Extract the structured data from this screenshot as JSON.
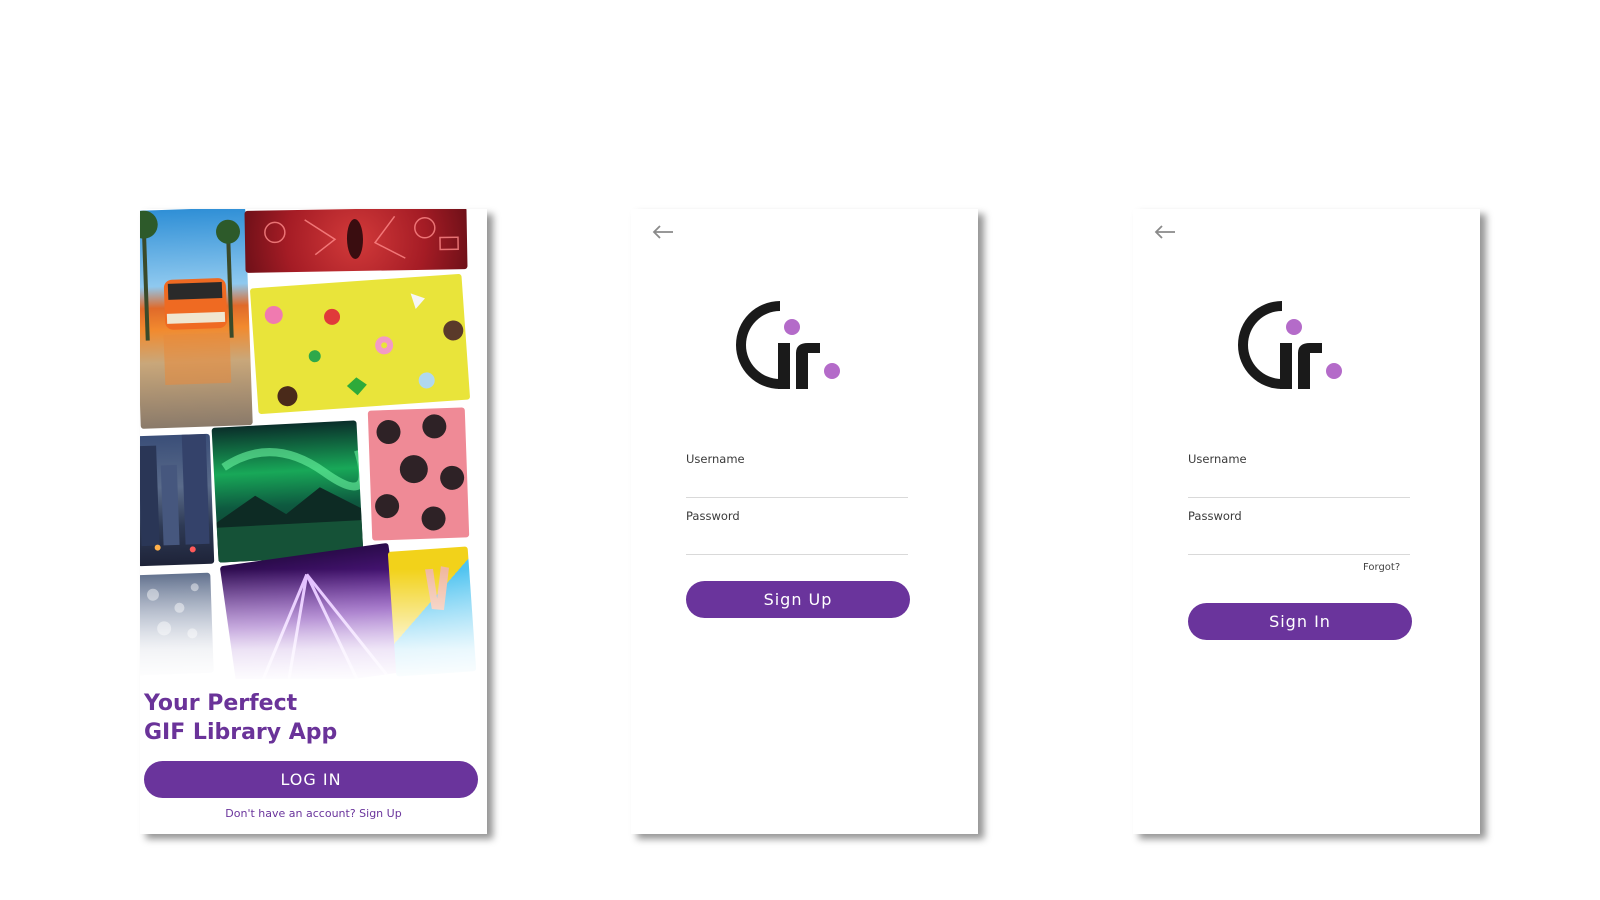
{
  "welcome_screen": {
    "headline_line1": "Your Perfect",
    "headline_line2": "GIF Library App",
    "login_button": "LOG IN",
    "signup_prompt": "Don't have an account? Sign Up"
  },
  "signup_screen": {
    "back_icon": "arrow-left-icon",
    "logo": "gif-logo",
    "username_label": "Username",
    "password_label": "Password",
    "submit_button": "Sign Up"
  },
  "signin_screen": {
    "back_icon": "arrow-left-icon",
    "logo": "gif-logo",
    "username_label": "Username",
    "password_label": "Password",
    "forgot_link": "Forgot?",
    "submit_button": "Sign In"
  },
  "colors": {
    "brand_purple": "#6a349c",
    "logo_dot": "#b46bc9",
    "logo_dark": "#1a1a1a"
  }
}
